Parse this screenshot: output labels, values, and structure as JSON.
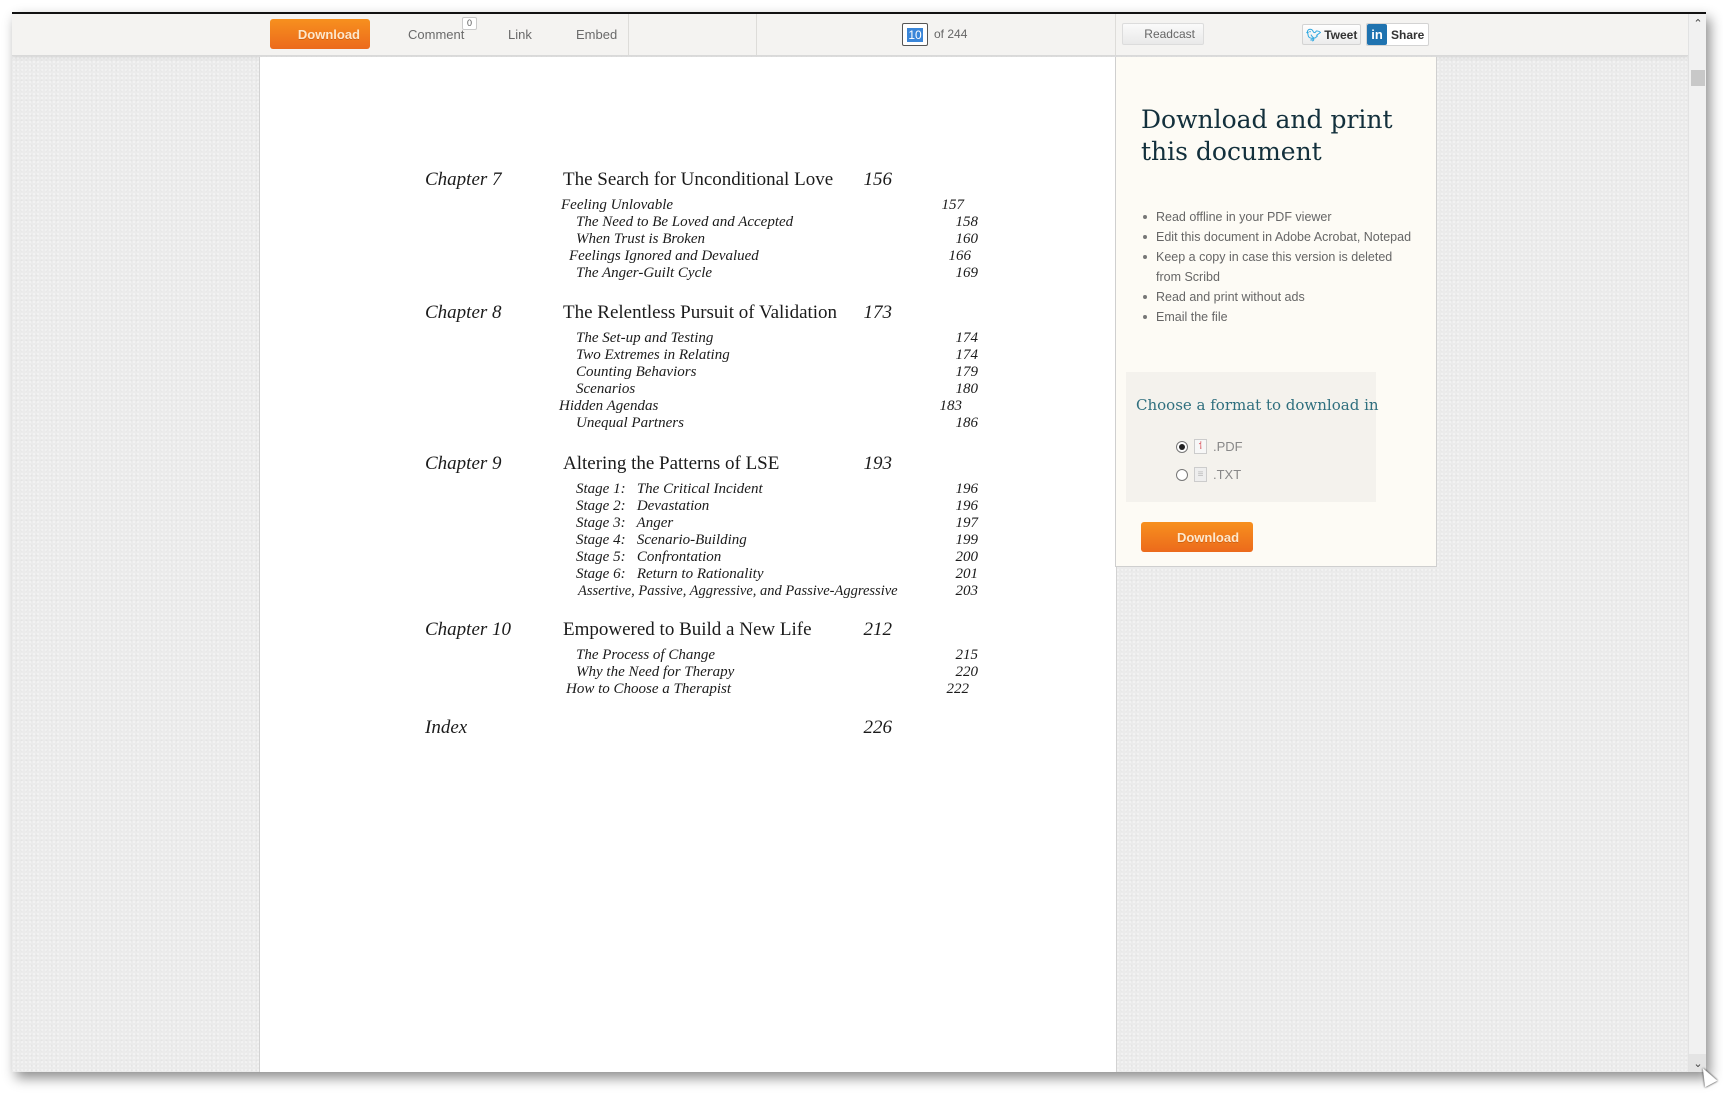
{
  "toolbar": {
    "download_label": "Download",
    "comment_label": "Comment",
    "comment_count": "0",
    "link_label": "Link",
    "embed_label": "Embed",
    "current_page": "10",
    "page_total": "of 244",
    "readcast_label": "Readcast",
    "tweet_label": "Tweet",
    "share_label": "Share",
    "linkedin_glyph": "in"
  },
  "toc": {
    "chapters": [
      {
        "label": "Chapter 7",
        "title": "The Search for Unconditional Love",
        "page": "156",
        "sections": [
          {
            "title": "Feeling Unlovable",
            "page": "157"
          },
          {
            "title": "The Need to Be Loved and Accepted",
            "page": "158"
          },
          {
            "title": "When Trust is Broken",
            "page": "160"
          },
          {
            "title": "Feelings Ignored and Devalued",
            "page": "166"
          },
          {
            "title": "The Anger-Guilt Cycle",
            "page": "169"
          }
        ]
      },
      {
        "label": "Chapter 8",
        "title": "The Relentless Pursuit of Validation",
        "page": "173",
        "sections": [
          {
            "title": "The Set-up and Testing",
            "page": "174"
          },
          {
            "title": "Two Extremes in Relating",
            "page": "174"
          },
          {
            "title": "Counting Behaviors",
            "page": "179"
          },
          {
            "title": "Scenarios",
            "page": "180"
          },
          {
            "title": "Hidden Agendas",
            "page": "183"
          },
          {
            "title": "Unequal Partners",
            "page": "186"
          }
        ]
      },
      {
        "label": "Chapter 9",
        "title": "Altering the Patterns of LSE",
        "page": "193",
        "sections": [
          {
            "title": "Stage 1:   The Critical Incident",
            "page": "196"
          },
          {
            "title": "Stage 2:   Devastation",
            "page": "196"
          },
          {
            "title": "Stage 3:   Anger",
            "page": "197"
          },
          {
            "title": "Stage 4:   Scenario-Building",
            "page": "199"
          },
          {
            "title": "Stage 5:   Confrontation",
            "page": "200"
          },
          {
            "title": "Stage 6:   Return to Rationality",
            "page": "201"
          },
          {
            "title": "Assertive, Passive, Aggressive, and Passive-Aggressive",
            "page": "203"
          }
        ]
      },
      {
        "label": "Chapter 10",
        "title": "Empowered to Build a New Life",
        "page": "212",
        "sections": [
          {
            "title": "The Process of Change",
            "page": "215"
          },
          {
            "title": "Why the Need for Therapy",
            "page": "220"
          },
          {
            "title": "How to Choose a Therapist",
            "page": "222"
          }
        ]
      }
    ],
    "index": {
      "label": "Index",
      "page": "226"
    }
  },
  "panel": {
    "heading": "Download and print this document",
    "benefits": [
      "Read offline in your PDF viewer",
      "Edit this document in Adobe Acrobat, Notepad",
      "Keep a copy in case this version is deleted from Scribd",
      "Read and print without ads",
      "Email the file"
    ],
    "format_title": "Choose a format to download in",
    "formats": [
      {
        "label": ".PDF",
        "selected": true
      },
      {
        "label": ".TXT",
        "selected": false
      }
    ],
    "download_label": "Download"
  },
  "colors": {
    "accent_orange": "#f07c1e",
    "heading_teal": "#2f6f7e",
    "page_selection": "#3a86d9"
  }
}
